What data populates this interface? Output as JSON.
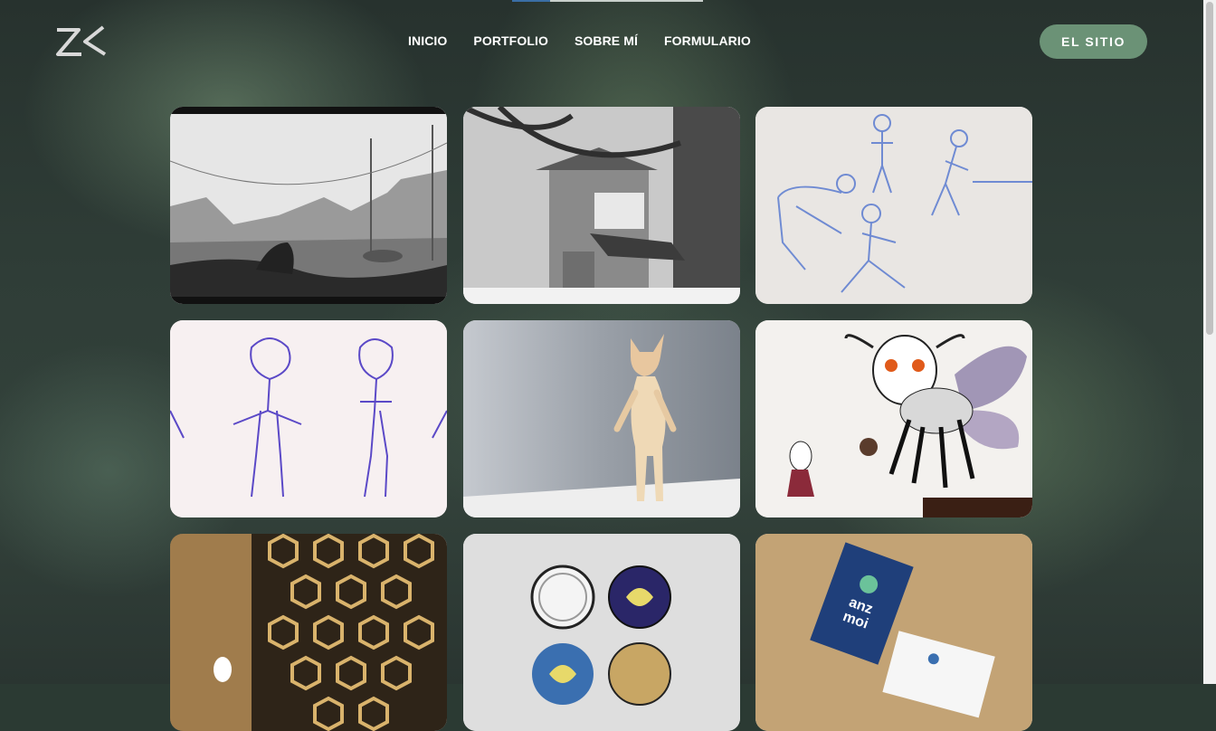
{
  "header": {
    "logo": {
      "icon": "zk-logo-icon",
      "text": "ZK"
    },
    "nav": [
      {
        "label": "INICIO"
      },
      {
        "label": "PORTFOLIO"
      },
      {
        "label": "SOBRE MÍ"
      },
      {
        "label": "FORMULARIO"
      }
    ],
    "cta_label": "EL SITIO",
    "accent_color": "#6b9276"
  },
  "portfolio": {
    "items": [
      {
        "subject": "grayscale-landscape-storyboard"
      },
      {
        "subject": "grayscale-treehouse-background"
      },
      {
        "subject": "blue-pencil-character-poses"
      },
      {
        "subject": "purple-character-turnaround-sketch"
      },
      {
        "subject": "3d-deer-character-render"
      },
      {
        "subject": "hollow-knight-moth-fanart"
      },
      {
        "subject": "golden-hexagon-environment"
      },
      {
        "subject": "button-badge-mockup"
      },
      {
        "subject": "business-card-mockup",
        "card_text": [
          "anz",
          "moi"
        ]
      }
    ]
  },
  "colors": {
    "scroll_indicator": "#3a6ea5"
  }
}
